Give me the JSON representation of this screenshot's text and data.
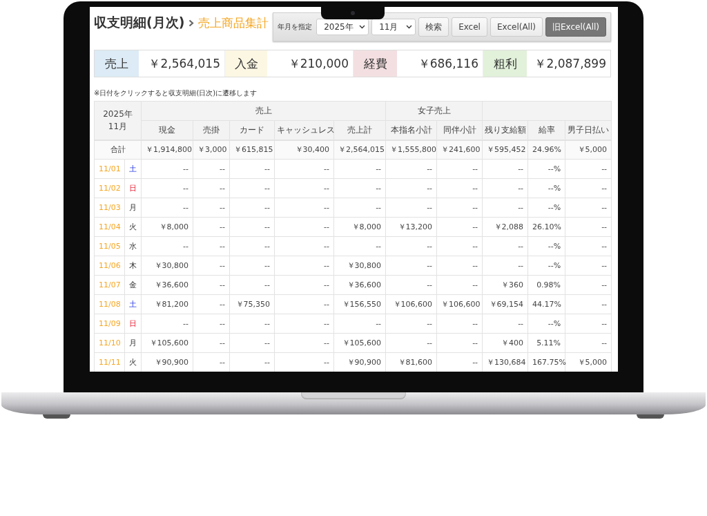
{
  "page": {
    "title": "収支明細(月次)",
    "subtitle": "売上商品集計"
  },
  "toolbar": {
    "label": "年月を指定",
    "year_select": {
      "value": "2025年"
    },
    "month_select": {
      "value": "11月"
    },
    "buttons": [
      {
        "label": "検索",
        "kind": "plain"
      },
      {
        "label": "Excel",
        "kind": "plain"
      },
      {
        "label": "Excel(All)",
        "kind": "plain"
      },
      {
        "label": "旧Excel(All)",
        "kind": "dark"
      }
    ]
  },
  "summary": [
    {
      "label": "売上",
      "value": "￥2,564,015",
      "color": "#dcebf5"
    },
    {
      "label": "入金",
      "value": "￥210,000",
      "color": "#fcf7e3"
    },
    {
      "label": "経費",
      "value": "￥686,116",
      "color": "#f3dfe1"
    },
    {
      "label": "粗利",
      "value": "￥2,087,899",
      "color": "#e2f1da"
    }
  ],
  "note": "※日付をクリックすると収支明細(日次)に遷移します",
  "table": {
    "period": "2025年\n11月",
    "groups": [
      {
        "label": "売上",
        "columns": [
          "現金",
          "売掛",
          "カード",
          "キャッシュレス",
          "売上計"
        ]
      },
      {
        "label": "女子売上",
        "columns": [
          "本指名小計",
          "同伴小計"
        ]
      },
      {
        "columns": [
          "残り支給額",
          "給率",
          "男子日払い"
        ]
      }
    ],
    "total": {
      "label": "合計",
      "cells": [
        "￥1,914,800",
        "￥3,000",
        "￥615,815",
        "￥30,400",
        "￥2,564,015",
        "￥1,555,800",
        "￥241,600",
        "￥595,452",
        "24.96%",
        "￥5,000"
      ]
    },
    "rows": [
      {
        "date": "11/01",
        "day": "土",
        "kind": "saturday",
        "cells": [
          "--",
          "--",
          "--",
          "--",
          "--",
          "--",
          "--",
          "--",
          "--%",
          "--"
        ]
      },
      {
        "date": "11/02",
        "day": "日",
        "kind": "sunday",
        "cells": [
          "--",
          "--",
          "--",
          "--",
          "--",
          "--",
          "--",
          "--",
          "--%",
          "--"
        ]
      },
      {
        "date": "11/03",
        "day": "月",
        "kind": "weekday",
        "cells": [
          "--",
          "--",
          "--",
          "--",
          "--",
          "--",
          "--",
          "--",
          "--%",
          "--"
        ]
      },
      {
        "date": "11/04",
        "day": "火",
        "kind": "weekday",
        "cells": [
          "￥8,000",
          "--",
          "--",
          "--",
          "￥8,000",
          "￥13,200",
          "--",
          "￥2,088",
          "26.10%",
          "--"
        ]
      },
      {
        "date": "11/05",
        "day": "水",
        "kind": "weekday",
        "cells": [
          "--",
          "--",
          "--",
          "--",
          "--",
          "--",
          "--",
          "--",
          "--%",
          "--"
        ]
      },
      {
        "date": "11/06",
        "day": "木",
        "kind": "weekday",
        "cells": [
          "￥30,800",
          "--",
          "--",
          "--",
          "￥30,800",
          "--",
          "--",
          "--",
          "--%",
          "--"
        ]
      },
      {
        "date": "11/07",
        "day": "金",
        "kind": "weekday",
        "cells": [
          "￥36,600",
          "--",
          "--",
          "--",
          "￥36,600",
          "--",
          "--",
          "￥360",
          "0.98%",
          "--"
        ]
      },
      {
        "date": "11/08",
        "day": "土",
        "kind": "saturday",
        "cells": [
          "￥81,200",
          "--",
          "￥75,350",
          "--",
          "￥156,550",
          "￥106,600",
          "￥106,600",
          "￥69,154",
          "44.17%",
          "--"
        ]
      },
      {
        "date": "11/09",
        "day": "日",
        "kind": "sunday",
        "cells": [
          "--",
          "--",
          "--",
          "--",
          "--",
          "--",
          "--",
          "--",
          "--%",
          "--"
        ]
      },
      {
        "date": "11/10",
        "day": "月",
        "kind": "weekday",
        "cells": [
          "￥105,600",
          "--",
          "--",
          "--",
          "￥105,600",
          "--",
          "--",
          "￥400",
          "5.11%",
          "--"
        ]
      },
      {
        "date": "11/11",
        "day": "火",
        "kind": "weekday",
        "cells": [
          "￥90,900",
          "--",
          "--",
          "--",
          "￥90,900",
          "￥81,600",
          "--",
          "￥130,684",
          "167.75%",
          "￥5,000"
        ]
      }
    ]
  }
}
